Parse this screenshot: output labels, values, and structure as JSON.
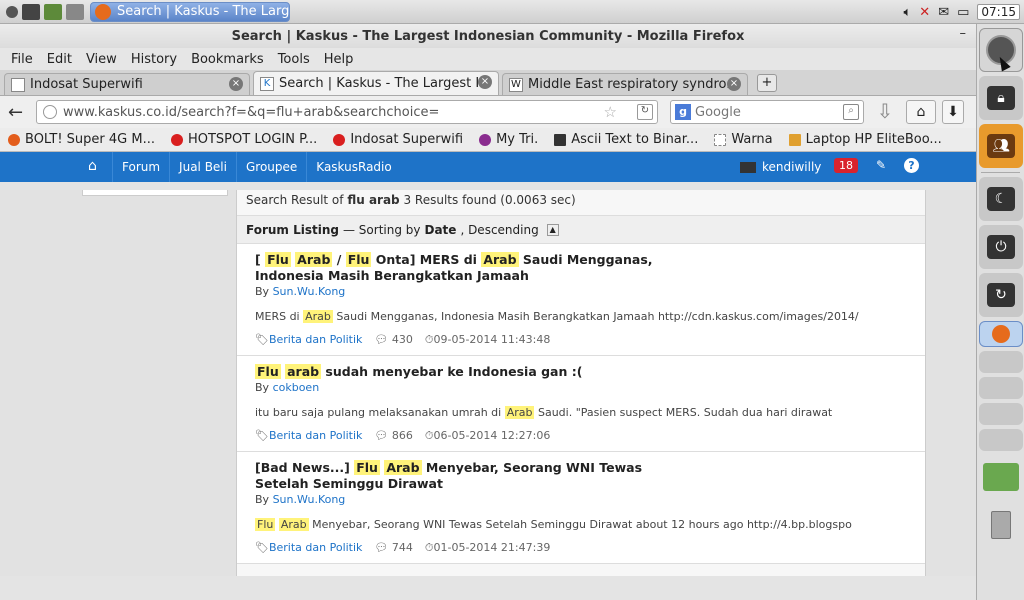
{
  "os_topbar": {
    "task_title": "Search | Kaskus - The Larg...",
    "clock": "07:15"
  },
  "window": {
    "title": "Search | Kaskus - The Largest Indonesian Community - Mozilla Firefox",
    "minimize": "–"
  },
  "menubar": [
    "File",
    "Edit",
    "View",
    "History",
    "Bookmarks",
    "Tools",
    "Help"
  ],
  "tabs": [
    {
      "label": "Indosat Superwifi",
      "active": false
    },
    {
      "label": "Search | Kaskus - The Largest I...",
      "active": true
    },
    {
      "label": "Middle East respiratory syndro...",
      "active": false
    }
  ],
  "newtab": "+",
  "navbar": {
    "back": "←",
    "url": "www.kaskus.co.id/search?f=&q=flu+arab&searchchoice=",
    "search_engine": "g",
    "search_placeholder": "Google",
    "download": "⇩",
    "home": "⌂",
    "menu": "⬇"
  },
  "bookmarks": [
    {
      "label": "BOLT! Super 4G M...",
      "icon_color": "#e35d1c"
    },
    {
      "label": "HOTSPOT LOGIN P...",
      "icon_color": "#d91f1f"
    },
    {
      "label": "Indosat Superwifi",
      "icon_color": "#d91f1f"
    },
    {
      "label": "My Tri.",
      "icon_color": "#8a2c8f"
    },
    {
      "label": "Ascii Text to Binar...",
      "icon_color": "#333333"
    },
    {
      "label": "Warna",
      "icon_color": "#ffffff"
    },
    {
      "label": "Laptop HP EliteBoo...",
      "icon_color": "#e0a030"
    }
  ],
  "kaskus_nav": {
    "items": [
      "Forum",
      "Jual Beli",
      "Groupee",
      "KaskusRadio"
    ],
    "username": "kendiwilly",
    "notifications": "18",
    "help": "?"
  },
  "search_result": {
    "prefix": "Search Result of",
    "query": "flu arab",
    "summary": "3 Results found (0.0063 sec)"
  },
  "listing": {
    "label": "Forum Listing",
    "sort_text": " — Sorting by ",
    "sort_field": "Date",
    "sort_order": ", Descending"
  },
  "results": [
    {
      "title_parts": [
        "[ ",
        "Flu",
        " ",
        "Arab",
        " / ",
        "Flu",
        " Onta] MERS di ",
        "Arab",
        " Saudi Mengganas, Indonesia Masih Berangkatkan Jamaah"
      ],
      "by": "By",
      "author": "Sun.Wu.Kong",
      "snippet_parts": [
        "MERS di ",
        "Arab",
        " Saudi Mengganas, Indonesia Masih Berangkatkan Jamaah http://cdn.kaskus.com/images/2014/"
      ],
      "category": "Berita dan Politik",
      "replies": "430",
      "date": "09-05-2014 11:43:48"
    },
    {
      "title_parts": [
        "",
        "Flu",
        " ",
        "arab",
        " sudah menyebar ke Indonesia gan :("
      ],
      "by": "By",
      "author": "cokboen",
      "snippet_parts": [
        "itu baru saja pulang melaksanakan umrah di ",
        "Arab",
        " Saudi. \"Pasien suspect MERS. Sudah dua hari dirawat"
      ],
      "category": "Berita dan Politik",
      "replies": "866",
      "date": "06-05-2014 12:27:06"
    },
    {
      "title_parts": [
        "[Bad News...] ",
        "Flu",
        " ",
        "Arab",
        " Menyebar, Seorang WNI Tewas Setelah Seminggu Dirawat"
      ],
      "by": "By",
      "author": "Sun.Wu.Kong",
      "snippet_parts": [
        "",
        "Flu",
        " ",
        "Arab",
        " Menyebar, Seorang WNI Tewas Setelah Seminggu Dirawat about 12 hours ago http://4.bp.blogspo"
      ],
      "category": "Berita dan Politik",
      "replies": "744",
      "date": "01-05-2014 21:47:39"
    }
  ]
}
